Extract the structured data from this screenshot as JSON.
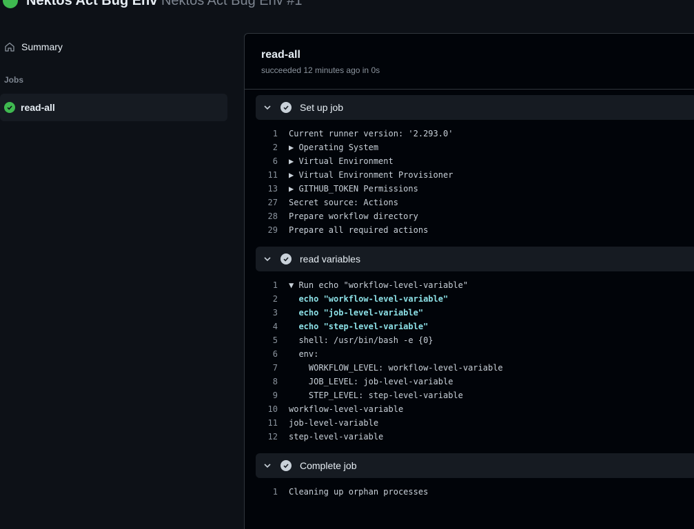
{
  "header": {
    "title": "Nektos Act Bug Env",
    "subtitle": "Nektos Act Bug Env #1"
  },
  "sidebar": {
    "summary_label": "Summary",
    "jobs_label": "Jobs",
    "job_label": "read-all"
  },
  "job": {
    "title": "read-all",
    "status": "succeeded 12 minutes ago in 0s"
  },
  "steps": [
    {
      "label": "Set up job",
      "lines": [
        {
          "num": "1",
          "text": "Current runner version: '2.293.0'"
        },
        {
          "num": "2",
          "text": "▶ Operating System"
        },
        {
          "num": "6",
          "text": "▶ Virtual Environment"
        },
        {
          "num": "11",
          "text": "▶ Virtual Environment Provisioner"
        },
        {
          "num": "13",
          "text": "▶ GITHUB_TOKEN Permissions"
        },
        {
          "num": "27",
          "text": "Secret source: Actions"
        },
        {
          "num": "28",
          "text": "Prepare workflow directory"
        },
        {
          "num": "29",
          "text": "Prepare all required actions"
        }
      ]
    },
    {
      "label": "read variables",
      "lines": [
        {
          "num": "1",
          "text": "▼ Run echo \"workflow-level-variable\""
        },
        {
          "num": "2",
          "text": "  echo \"workflow-level-variable\""
        },
        {
          "num": "3",
          "text": "  echo \"job-level-variable\""
        },
        {
          "num": "4",
          "text": "  echo \"step-level-variable\""
        },
        {
          "num": "5",
          "text": "  shell: /usr/bin/bash -e {0}"
        },
        {
          "num": "6",
          "text": "  env:"
        },
        {
          "num": "7",
          "text": "    WORKFLOW_LEVEL: workflow-level-variable"
        },
        {
          "num": "8",
          "text": "    JOB_LEVEL: job-level-variable"
        },
        {
          "num": "9",
          "text": "    STEP_LEVEL: step-level-variable"
        },
        {
          "num": "10",
          "text": "workflow-level-variable"
        },
        {
          "num": "11",
          "text": "job-level-variable"
        },
        {
          "num": "12",
          "text": "step-level-variable"
        }
      ]
    },
    {
      "label": "Complete job",
      "lines": [
        {
          "num": "1",
          "text": "Cleaning up orphan processes"
        }
      ]
    }
  ],
  "colors": {
    "success": "#3fb950",
    "background": "#0d1117",
    "panel": "#010409",
    "step_header": "#161b22",
    "command": "#8ce0e6"
  }
}
